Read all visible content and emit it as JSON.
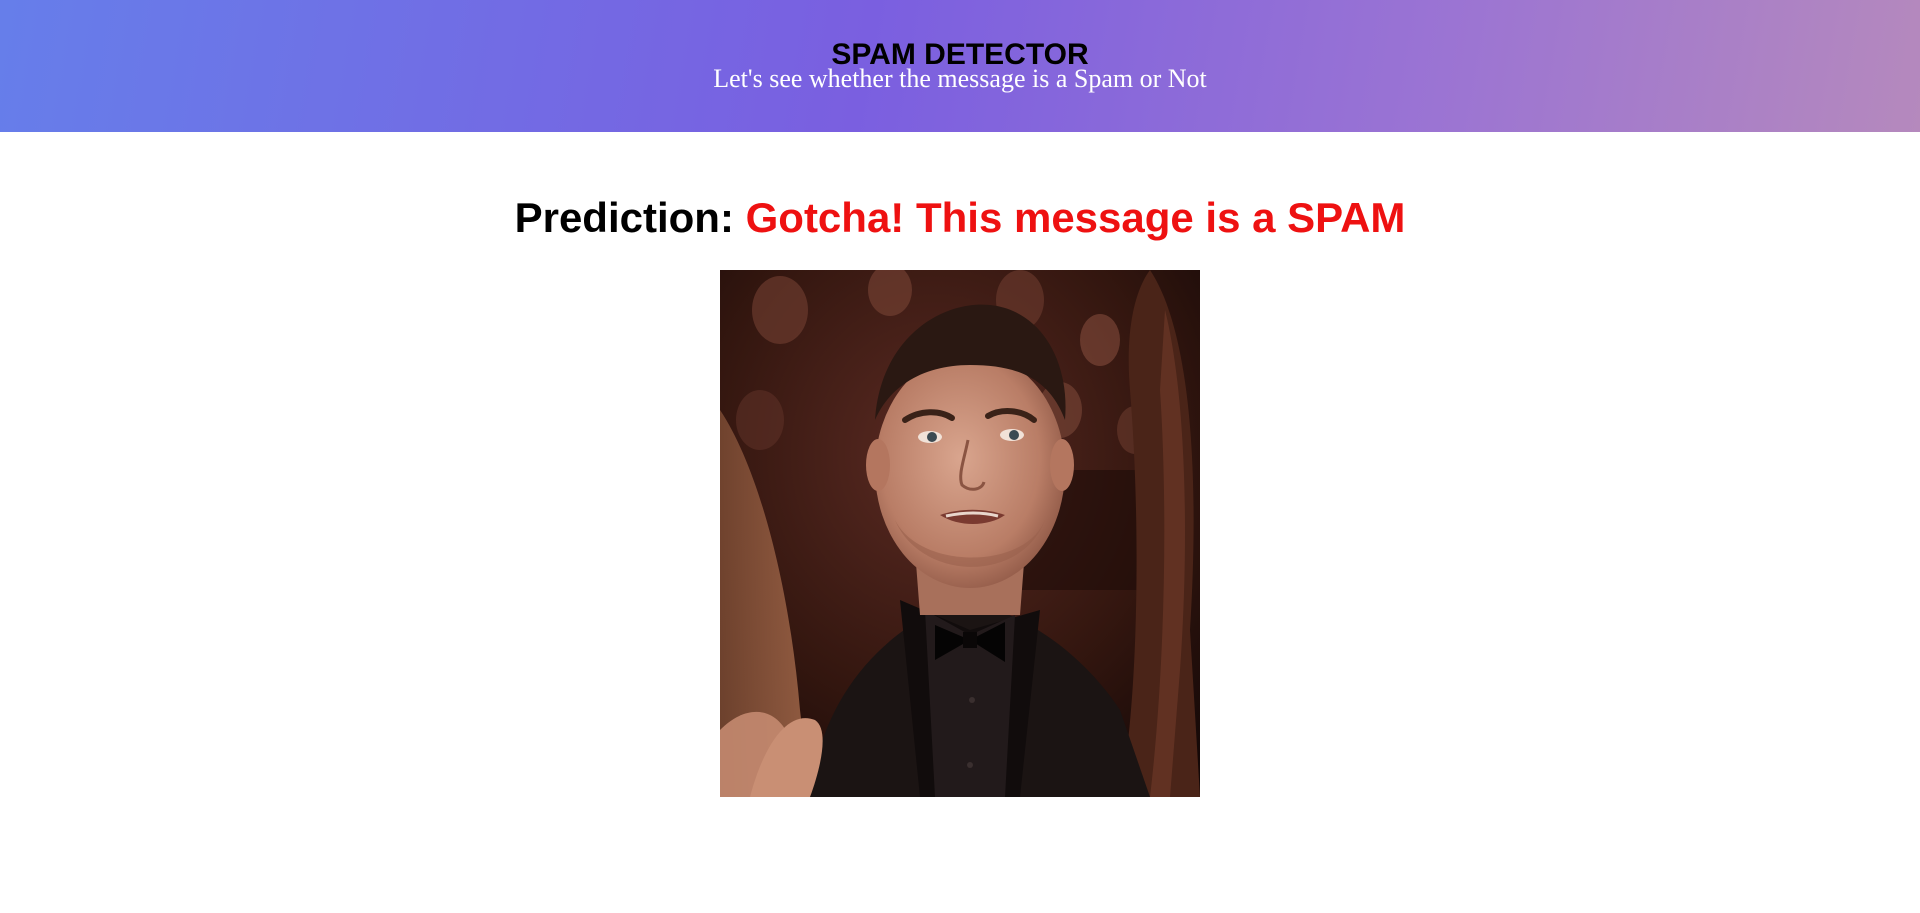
{
  "header": {
    "title": "SPAM DETECTOR",
    "subtitle": "Let's see whether the message is a Spam or Not",
    "gradient_colors": [
      "#667eea",
      "#764ba2",
      "#b589bd"
    ]
  },
  "result": {
    "label": "Prediction:",
    "text": "Gotcha! This message is a SPAM",
    "text_color": "#ee1111"
  },
  "image": {
    "alt": "man in black suit and bow tie in an audience"
  }
}
